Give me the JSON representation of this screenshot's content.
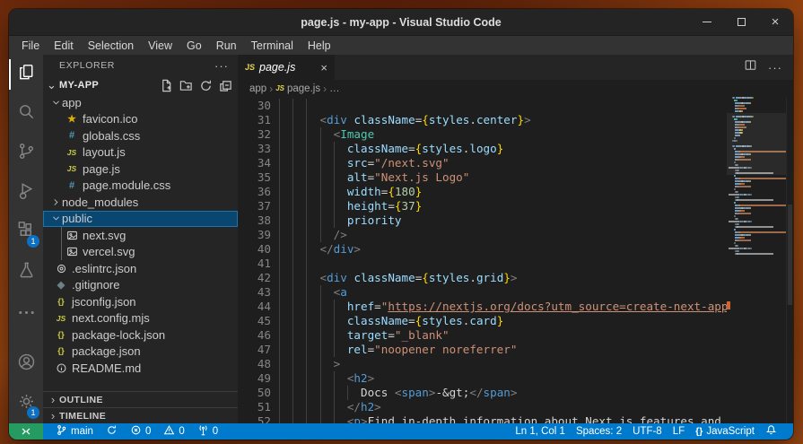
{
  "window": {
    "title": "page.js - my-app - Visual Studio Code",
    "controls": [
      "minimize",
      "maximize",
      "close"
    ]
  },
  "colors": {
    "statusbar_blue": "#007acc",
    "remote_green": "#259b62",
    "selection_blue": "#094771",
    "badge_blue": "#0e70c0",
    "editor_bg": "#1e1e1e",
    "sidebar_bg": "#252526",
    "activity_bg": "#333333"
  },
  "menu": {
    "items": [
      "File",
      "Edit",
      "Selection",
      "View",
      "Go",
      "Run",
      "Terminal",
      "Help"
    ]
  },
  "activity_bar": {
    "top": [
      {
        "name": "explorer",
        "icon": "files",
        "active": true
      },
      {
        "name": "search",
        "icon": "search"
      },
      {
        "name": "source-control",
        "icon": "source-control"
      },
      {
        "name": "run-and-debug",
        "icon": "debug"
      },
      {
        "name": "extensions",
        "icon": "extensions",
        "badge": "1"
      },
      {
        "name": "testing",
        "icon": "beaker"
      },
      {
        "name": "more",
        "icon": "ellipsis",
        "gap": true
      }
    ],
    "bottom": [
      {
        "name": "accounts",
        "icon": "account"
      },
      {
        "name": "settings",
        "icon": "gear",
        "badge": "1"
      }
    ]
  },
  "sidebar": {
    "header": "EXPLORER",
    "header_more": "···",
    "section": "MY-APP",
    "actions": [
      "new-file",
      "new-folder",
      "refresh",
      "collapse-all"
    ],
    "tree": [
      {
        "label": "app",
        "kind": "folder",
        "expanded": true,
        "depth": 0
      },
      {
        "label": "favicon.ico",
        "icon": "favicon",
        "depth": 1
      },
      {
        "label": "globals.css",
        "icon": "css",
        "depth": 1
      },
      {
        "label": "layout.js",
        "icon": "js",
        "depth": 1
      },
      {
        "label": "page.js",
        "icon": "js",
        "depth": 1
      },
      {
        "label": "page.module.css",
        "icon": "css",
        "depth": 1
      },
      {
        "label": "node_modules",
        "kind": "folder",
        "expanded": false,
        "depth": 0
      },
      {
        "label": "public",
        "kind": "folder",
        "expanded": true,
        "depth": 0,
        "selected": true
      },
      {
        "label": "next.svg",
        "icon": "image",
        "depth": 1,
        "guide": true
      },
      {
        "label": "vercel.svg",
        "icon": "image",
        "depth": 1,
        "guide": true
      },
      {
        "label": ".eslintrc.json",
        "icon": "eslint",
        "depth": 0
      },
      {
        "label": ".gitignore",
        "icon": "git",
        "depth": 0
      },
      {
        "label": "jsconfig.json",
        "icon": "json",
        "depth": 0
      },
      {
        "label": "next.config.mjs",
        "icon": "js",
        "depth": 0
      },
      {
        "label": "package-lock.json",
        "icon": "json",
        "depth": 0
      },
      {
        "label": "package.json",
        "icon": "json",
        "depth": 0
      },
      {
        "label": "README.md",
        "icon": "info",
        "depth": 0
      }
    ],
    "panels": [
      "OUTLINE",
      "TIMELINE"
    ]
  },
  "editor": {
    "tab": {
      "label": "page.js",
      "icon": "js",
      "close": "×",
      "preview_italic": true
    },
    "breadcrumbs": [
      {
        "label": "app"
      },
      {
        "label": "page.js",
        "icon": "js"
      },
      {
        "label": "…"
      }
    ],
    "code_lines": [
      {
        "n": "30",
        "g": 3,
        "t": []
      },
      {
        "n": "31",
        "g": 3,
        "t": [
          [
            "w",
            "      "
          ],
          [
            "p",
            "<"
          ],
          [
            "t",
            "div"
          ],
          [
            "w",
            " "
          ],
          [
            "a",
            "className"
          ],
          [
            "o",
            "="
          ],
          [
            "b",
            "{"
          ],
          [
            "v",
            "styles"
          ],
          [
            "o",
            "."
          ],
          [
            "v",
            "center"
          ],
          [
            "b",
            "}"
          ],
          [
            "p",
            ">"
          ]
        ]
      },
      {
        "n": "32",
        "g": 4,
        "t": [
          [
            "w",
            "        "
          ],
          [
            "p",
            "<"
          ],
          [
            "c",
            "Image"
          ]
        ]
      },
      {
        "n": "33",
        "g": 5,
        "t": [
          [
            "w",
            "          "
          ],
          [
            "a",
            "className"
          ],
          [
            "o",
            "="
          ],
          [
            "b",
            "{"
          ],
          [
            "v",
            "styles"
          ],
          [
            "o",
            "."
          ],
          [
            "v",
            "logo"
          ],
          [
            "b",
            "}"
          ]
        ]
      },
      {
        "n": "34",
        "g": 5,
        "t": [
          [
            "w",
            "          "
          ],
          [
            "a",
            "src"
          ],
          [
            "o",
            "="
          ],
          [
            "s",
            "\"/next.svg\""
          ]
        ]
      },
      {
        "n": "35",
        "g": 5,
        "t": [
          [
            "w",
            "          "
          ],
          [
            "a",
            "alt"
          ],
          [
            "o",
            "="
          ],
          [
            "s",
            "\"Next.js Logo\""
          ]
        ]
      },
      {
        "n": "36",
        "g": 5,
        "t": [
          [
            "w",
            "          "
          ],
          [
            "a",
            "width"
          ],
          [
            "o",
            "="
          ],
          [
            "b",
            "{"
          ],
          [
            "n2",
            "180"
          ],
          [
            "b",
            "}"
          ]
        ]
      },
      {
        "n": "37",
        "g": 5,
        "t": [
          [
            "w",
            "          "
          ],
          [
            "a",
            "height"
          ],
          [
            "o",
            "="
          ],
          [
            "b",
            "{"
          ],
          [
            "n2",
            "37"
          ],
          [
            "b",
            "}"
          ]
        ]
      },
      {
        "n": "38",
        "g": 5,
        "t": [
          [
            "w",
            "          "
          ],
          [
            "a",
            "priority"
          ]
        ]
      },
      {
        "n": "39",
        "g": 4,
        "t": [
          [
            "w",
            "        "
          ],
          [
            "p",
            "/>"
          ]
        ]
      },
      {
        "n": "40",
        "g": 3,
        "t": [
          [
            "w",
            "      "
          ],
          [
            "p",
            "</"
          ],
          [
            "t",
            "div"
          ],
          [
            "p",
            ">"
          ]
        ]
      },
      {
        "n": "41",
        "g": 3,
        "t": []
      },
      {
        "n": "42",
        "g": 3,
        "t": [
          [
            "w",
            "      "
          ],
          [
            "p",
            "<"
          ],
          [
            "t",
            "div"
          ],
          [
            "w",
            " "
          ],
          [
            "a",
            "className"
          ],
          [
            "o",
            "="
          ],
          [
            "b",
            "{"
          ],
          [
            "v",
            "styles"
          ],
          [
            "o",
            "."
          ],
          [
            "v",
            "grid"
          ],
          [
            "b",
            "}"
          ],
          [
            "p",
            ">"
          ]
        ]
      },
      {
        "n": "43",
        "g": 4,
        "t": [
          [
            "w",
            "        "
          ],
          [
            "p",
            "<"
          ],
          [
            "t",
            "a"
          ]
        ]
      },
      {
        "n": "44",
        "g": 5,
        "t": [
          [
            "w",
            "          "
          ],
          [
            "a",
            "href"
          ],
          [
            "o",
            "="
          ],
          [
            "s",
            "\""
          ],
          [
            "u",
            "https://nextjs.org/docs?utm_source=create-next-app&utm_medium=appdir-template&utm_campaign=create-next-app"
          ]
        ]
      },
      {
        "n": "45",
        "g": 5,
        "t": [
          [
            "w",
            "          "
          ],
          [
            "a",
            "className"
          ],
          [
            "o",
            "="
          ],
          [
            "b",
            "{"
          ],
          [
            "v",
            "styles"
          ],
          [
            "o",
            "."
          ],
          [
            "v",
            "card"
          ],
          [
            "b",
            "}"
          ]
        ]
      },
      {
        "n": "46",
        "g": 5,
        "t": [
          [
            "w",
            "          "
          ],
          [
            "a",
            "target"
          ],
          [
            "o",
            "="
          ],
          [
            "s",
            "\"_blank\""
          ]
        ]
      },
      {
        "n": "47",
        "g": 5,
        "t": [
          [
            "w",
            "          "
          ],
          [
            "a",
            "rel"
          ],
          [
            "o",
            "="
          ],
          [
            "s",
            "\"noopener noreferrer\""
          ]
        ]
      },
      {
        "n": "48",
        "g": 4,
        "t": [
          [
            "w",
            "        "
          ],
          [
            "p",
            ">"
          ]
        ]
      },
      {
        "n": "49",
        "g": 5,
        "t": [
          [
            "w",
            "          "
          ],
          [
            "p",
            "<"
          ],
          [
            "t",
            "h2"
          ],
          [
            "p",
            ">"
          ]
        ]
      },
      {
        "n": "50",
        "g": 6,
        "t": [
          [
            "w",
            "            Docs "
          ],
          [
            "p",
            "<"
          ],
          [
            "t",
            "span"
          ],
          [
            "p",
            ">"
          ],
          [
            "w",
            "-&gt;"
          ],
          [
            "p",
            "</"
          ],
          [
            "t",
            "span"
          ],
          [
            "p",
            ">"
          ]
        ]
      },
      {
        "n": "51",
        "g": 5,
        "t": [
          [
            "w",
            "          "
          ],
          [
            "p",
            "</"
          ],
          [
            "t",
            "h2"
          ],
          [
            "p",
            ">"
          ]
        ]
      },
      {
        "n": "52",
        "g": 5,
        "t": [
          [
            "w",
            "          "
          ],
          [
            "p",
            "<"
          ],
          [
            "t",
            "p"
          ],
          [
            "p",
            ">"
          ],
          [
            "w",
            "Find in-depth information about Next.js features and API."
          ]
        ]
      }
    ]
  },
  "status_bar": {
    "left": [
      {
        "name": "branch",
        "icon": "branch",
        "label": "main"
      },
      {
        "name": "sync",
        "icon": "sync",
        "label": ""
      },
      {
        "name": "errors",
        "icon": "error",
        "label": "0"
      },
      {
        "name": "warnings",
        "icon": "warning",
        "label": "0"
      },
      {
        "name": "ports",
        "icon": "radio-tower",
        "label": "0"
      }
    ],
    "right": [
      {
        "name": "cursor-position",
        "label": "Ln 1, Col 1"
      },
      {
        "name": "indentation",
        "label": "Spaces: 2"
      },
      {
        "name": "encoding",
        "label": "UTF-8"
      },
      {
        "name": "eol",
        "label": "LF"
      },
      {
        "name": "language-mode",
        "icon": "braces",
        "label": "JavaScript"
      },
      {
        "name": "notifications",
        "icon": "bell",
        "label": ""
      }
    ]
  }
}
